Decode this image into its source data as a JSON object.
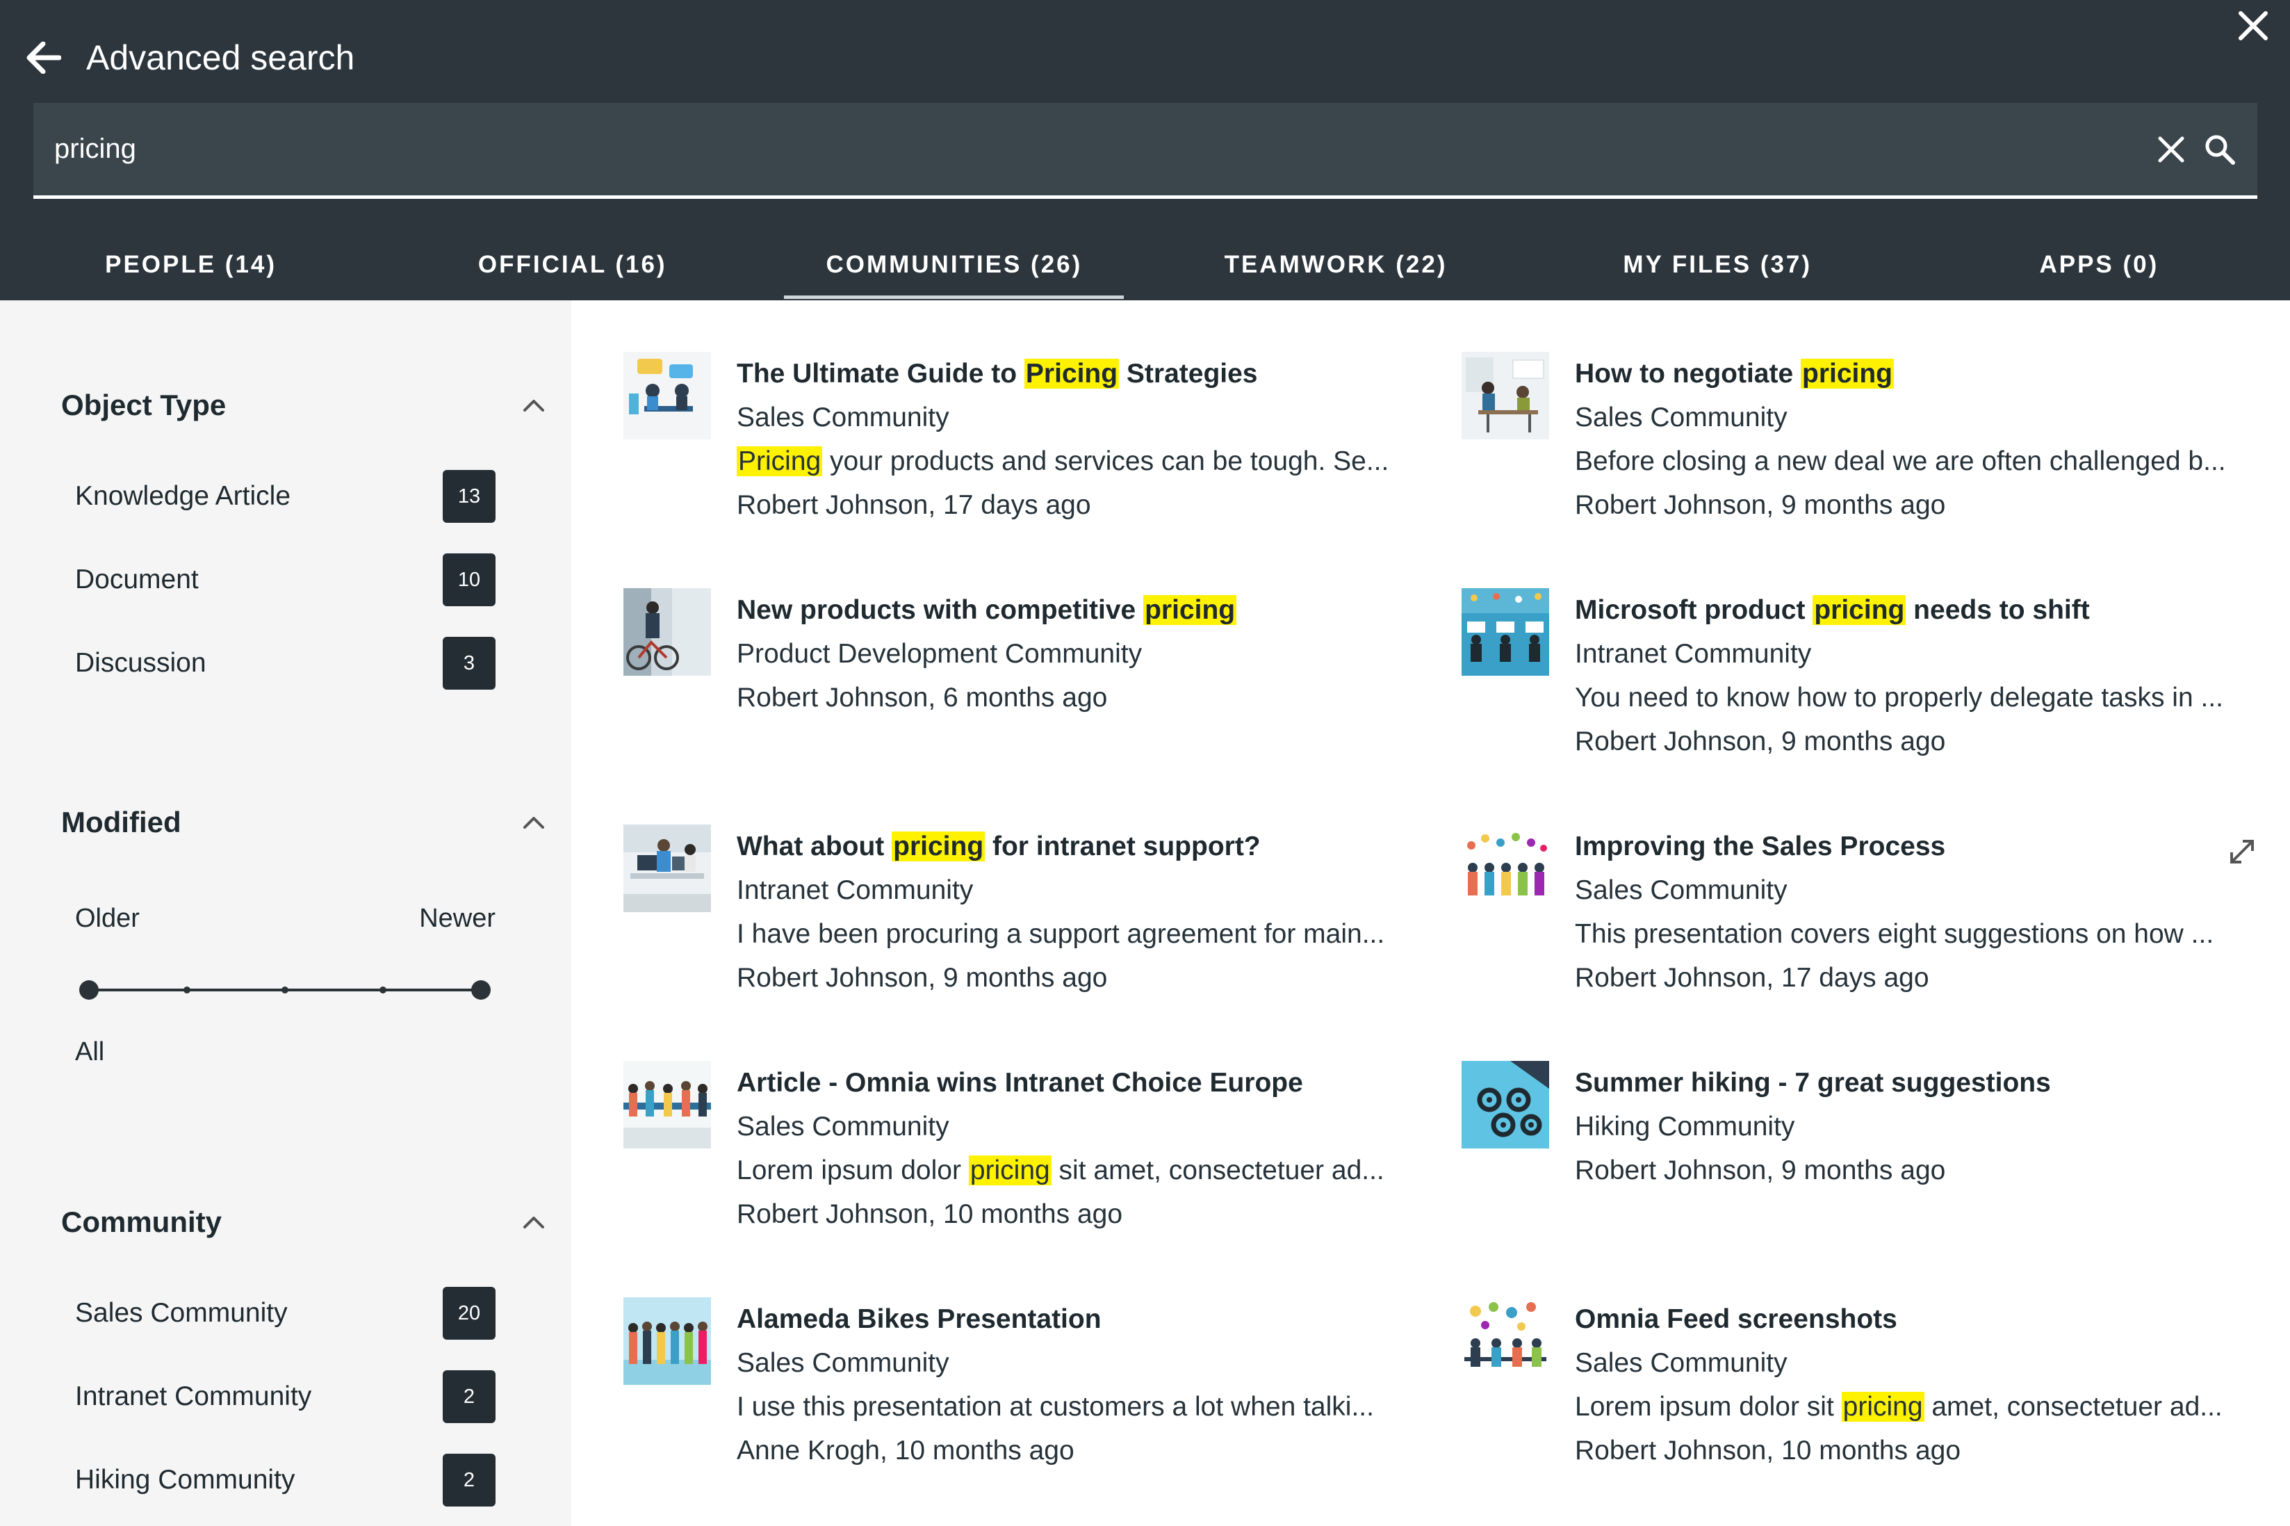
{
  "header": {
    "title": "Advanced search",
    "search_value": "pricing",
    "search_placeholder": ""
  },
  "tabs": [
    {
      "label": "PEOPLE (14)",
      "active": false
    },
    {
      "label": "OFFICIAL (16)",
      "active": false
    },
    {
      "label": "COMMUNITIES (26)",
      "active": true
    },
    {
      "label": "TEAMWORK (22)",
      "active": false
    },
    {
      "label": "MY FILES (37)",
      "active": false
    },
    {
      "label": "APPS (0)",
      "active": false
    }
  ],
  "filters": {
    "object_type": {
      "title": "Object Type",
      "items": [
        {
          "label": "Knowledge Article",
          "count": "13"
        },
        {
          "label": "Document",
          "count": "10"
        },
        {
          "label": "Discussion",
          "count": "3"
        }
      ]
    },
    "modified": {
      "title": "Modified",
      "older": "Older",
      "newer": "Newer",
      "selection": "All"
    },
    "community": {
      "title": "Community",
      "items": [
        {
          "label": "Sales Community",
          "count": "20"
        },
        {
          "label": "Intranet Community",
          "count": "2"
        },
        {
          "label": "Hiking Community",
          "count": "2"
        }
      ]
    }
  },
  "results": [
    {
      "title_pre": "The Ultimate Guide to ",
      "title_hl": "Pricing",
      "title_post": " Strategies",
      "community": "Sales Community",
      "snippet_pre": "",
      "snippet_hl": "Pricing",
      "snippet_post": " your products and services can be tough. Se...",
      "meta": "Robert Johnson, 17 days ago",
      "thumb": "chat-meeting"
    },
    {
      "title_pre": "How to negotiate ",
      "title_hl": "pricing",
      "title_post": "",
      "community": "Sales Community",
      "snippet_pre": "Before closing a new deal we are often challenged b...",
      "snippet_hl": "",
      "snippet_post": "",
      "meta": "Robert Johnson, 9 months ago",
      "thumb": "negotiation"
    },
    {
      "title_pre": "New products with competitive ",
      "title_hl": "pricing",
      "title_post": "",
      "community": "Product Development Community",
      "snippet_pre": "",
      "snippet_hl": "",
      "snippet_post": "",
      "meta": "Robert Johnson, 6 months ago",
      "thumb": "bicycle"
    },
    {
      "title_pre": "Microsoft product ",
      "title_hl": "pricing",
      "title_post": " needs to shift",
      "community": "Intranet Community",
      "snippet_pre": "You need to know how to properly delegate tasks in ...",
      "snippet_hl": "",
      "snippet_post": "",
      "meta": "Robert Johnson, 9 months ago",
      "thumb": "workstations"
    },
    {
      "title_pre": "What about ",
      "title_hl": "pricing",
      "title_post": " for intranet support?",
      "community": "Intranet Community",
      "snippet_pre": "I have been procuring a support agreement for main...",
      "snippet_hl": "",
      "snippet_post": "",
      "meta": "Robert Johnson, 9 months ago",
      "thumb": "office"
    },
    {
      "title_pre": "Improving the Sales Process",
      "title_hl": "",
      "title_post": "",
      "community": "Sales Community",
      "snippet_pre": "This presentation covers eight suggestions on how ...",
      "snippet_hl": "",
      "snippet_post": "",
      "meta": "Robert Johnson, 17 days ago",
      "thumb": "crowd-icons"
    },
    {
      "title_pre": "Article - Omnia wins Intranet Choice Europe",
      "title_hl": "",
      "title_post": "",
      "community": "Sales Community",
      "snippet_pre": "Lorem ipsum dolor ",
      "snippet_hl": "pricing",
      "snippet_post": " sit amet, consectetuer ad...",
      "meta": "Robert Johnson, 10 months ago",
      "thumb": "team-table"
    },
    {
      "title_pre": "Summer hiking - 7 great suggestions",
      "title_hl": "",
      "title_post": "",
      "community": "Hiking Community",
      "snippet_pre": "",
      "snippet_hl": "",
      "snippet_post": "",
      "meta": "Robert Johnson, 9 months ago",
      "thumb": "gears"
    },
    {
      "title_pre": "Alameda Bikes Presentation",
      "title_hl": "",
      "title_post": "",
      "community": "Sales Community",
      "snippet_pre": "I use this presentation at customers a lot when talki...",
      "snippet_hl": "",
      "snippet_post": "",
      "meta": "Anne Krogh, 10 months ago",
      "thumb": "people-row"
    },
    {
      "title_pre": "Omnia Feed screenshots",
      "title_hl": "",
      "title_post": "",
      "community": "Sales Community",
      "snippet_pre": "Lorem ipsum dolor sit ",
      "snippet_hl": "pricing",
      "snippet_post": " amet, consectetuer ad...",
      "meta": "Robert Johnson, 10 months ago",
      "thumb": "social-feed"
    }
  ],
  "colors": {
    "header_bg": "#2d363d",
    "search_bg": "#3b454c",
    "sidebar_bg": "#f5f5f5",
    "badge_bg": "#242d33",
    "highlight": "#fff200"
  },
  "icons": [
    "back-arrow-icon",
    "close-icon",
    "clear-icon",
    "search-icon",
    "chevron-up-icon",
    "expand-icon"
  ]
}
